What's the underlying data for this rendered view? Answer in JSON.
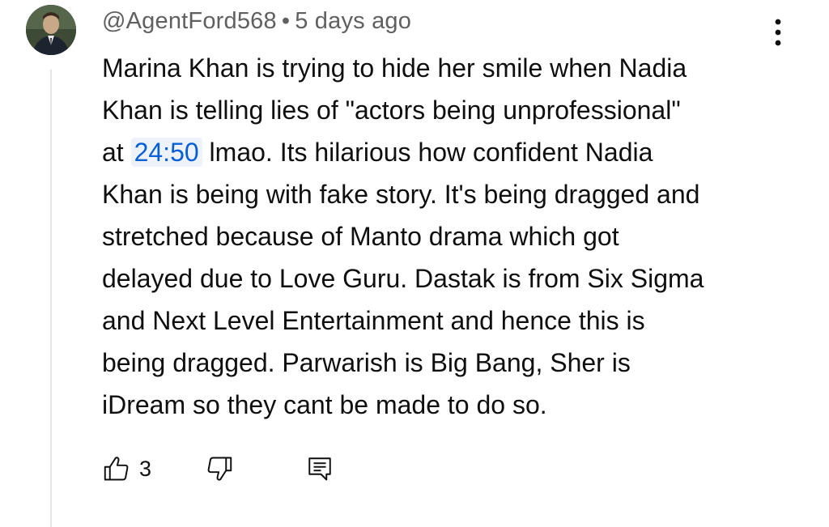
{
  "comment": {
    "author": "@AgentFord568",
    "separator": "•",
    "time_ago": "5 days ago",
    "lines": [
      "Marina Khan is trying to hide her smile when Nadia",
      "Khan is telling lies of \"actors being unprofessional\"",
      "at ",
      "Khan is being with fake story. It's being dragged and",
      "stretched because of Manto drama which got",
      "delayed due to Love Guru. Dastak is from Six Sigma",
      "and Next Level Entertainment and hence this is",
      "being dragged. Parwarish is Big Bang, Sher is",
      "iDream so they cant be made to do so."
    ],
    "timestamp_link": "24:50",
    "after_timestamp": " lmao. Its hilarious how confident Nadia",
    "like_count": "3"
  },
  "icons": {
    "avatar": "avatar",
    "menu": "more-vert-icon",
    "like": "thumb-up-icon",
    "dislike": "thumb-down-icon",
    "reply": "comment-reply-icon"
  },
  "colors": {
    "link": "#065fd4",
    "meta_text": "#606060",
    "body_text": "#0f0f0f"
  }
}
